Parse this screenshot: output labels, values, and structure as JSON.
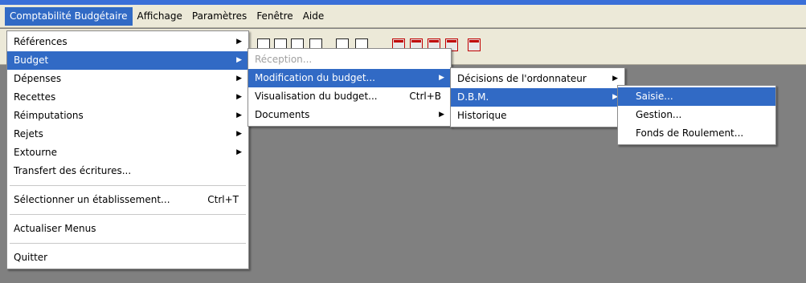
{
  "menubar": {
    "items": [
      {
        "label": "Comptabilité Budgétaire",
        "active": true
      },
      {
        "label": "Affichage"
      },
      {
        "label": "Paramètres"
      },
      {
        "label": "Fenêtre"
      },
      {
        "label": "Aide"
      }
    ]
  },
  "main_menu": {
    "items": [
      {
        "label": "Références",
        "submenu": true
      },
      {
        "label": "Budget",
        "submenu": true,
        "selected": true
      },
      {
        "label": "Dépenses",
        "submenu": true
      },
      {
        "label": "Recettes",
        "submenu": true
      },
      {
        "label": "Réimputations",
        "submenu": true
      },
      {
        "label": "Rejets",
        "submenu": true
      },
      {
        "label": "Extourne",
        "submenu": true
      },
      {
        "label": "Transfert des écritures..."
      },
      {
        "label": "Sélectionner un établissement...",
        "shortcut": "Ctrl+T"
      },
      {
        "label": "Actualiser Menus"
      },
      {
        "label": "Quitter"
      }
    ]
  },
  "budget_menu": {
    "items": [
      {
        "label": "Réception...",
        "disabled": true
      },
      {
        "label": "Modification du budget...",
        "submenu": true,
        "selected": true
      },
      {
        "label": "Visualisation du budget...",
        "shortcut": "Ctrl+B"
      },
      {
        "label": "Documents",
        "submenu": true
      }
    ]
  },
  "modification_menu": {
    "items": [
      {
        "label": "Décisions de l'ordonnateur",
        "submenu": true
      },
      {
        "label": "D.B.M.",
        "submenu": true,
        "selected": true
      },
      {
        "label": "Historique"
      }
    ]
  },
  "dbm_menu": {
    "items": [
      {
        "label": "Saisie...",
        "selected": true
      },
      {
        "label": "Gestion..."
      },
      {
        "label": "Fonds de Roulement..."
      }
    ]
  },
  "icons": {
    "submenu_arrow": "▶"
  },
  "colors": {
    "highlight": "#316ac5",
    "desktop": "#808080",
    "chrome": "#ece9d8"
  }
}
